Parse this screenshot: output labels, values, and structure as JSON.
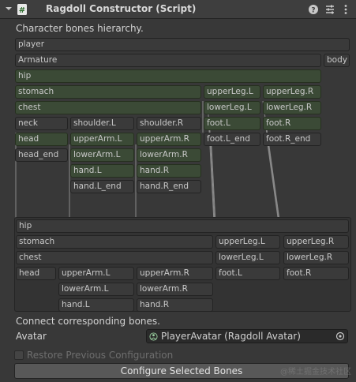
{
  "header": {
    "title": "Ragdoll Constructor (Script)",
    "icons": [
      "foldout-arrow-icon",
      "script-icon",
      "help-icon",
      "preset-icon",
      "context-menu-icon"
    ]
  },
  "section_hierarchy_label": "Character bones hierarchy.",
  "hierarchy": {
    "player": "player",
    "armature": "Armature",
    "body": "body",
    "hip": "hip",
    "stomach": "stomach",
    "chest": "chest",
    "neck": "neck",
    "head": "head",
    "head_end": "head_end",
    "shoulder_l": "shoulder.L",
    "upperarm_l": "upperArm.L",
    "lowerarm_l": "lowerArm.L",
    "hand_l": "hand.L",
    "hand_l_end": "hand.L_end",
    "shoulder_r": "shoulder.R",
    "upperarm_r": "upperArm.R",
    "lowerarm_r": "lowerArm.R",
    "hand_r": "hand.R",
    "hand_r_end": "hand.R_end",
    "upperleg_l": "upperLeg.L",
    "lowerleg_l": "lowerLeg.L",
    "foot_l": "foot.L",
    "foot_l_end": "foot.L_end",
    "upperleg_r": "upperLeg.R",
    "lowerleg_r": "lowerLeg.R",
    "foot_r": "foot.R",
    "foot_r_end": "foot.R_end"
  },
  "ragdoll": {
    "hip": "hip",
    "stomach": "stomach",
    "chest": "chest",
    "head": "head",
    "upperarm_l": "upperArm.L",
    "lowerarm_l": "lowerArm.L",
    "hand_l": "hand.L",
    "upperarm_r": "upperArm.R",
    "lowerarm_r": "lowerArm.R",
    "hand_r": "hand.R",
    "upperleg_l": "upperLeg.L",
    "lowerleg_l": "lowerLeg.L",
    "foot_l": "foot.L",
    "upperleg_r": "upperLeg.R",
    "lowerleg_r": "lowerLeg.R",
    "foot_r": "foot.R"
  },
  "connect_label": "Connect corresponding bones.",
  "avatar": {
    "label": "Avatar",
    "value": "PlayerAvatar (Ragdoll Avatar)"
  },
  "restore_label": "Restore Previous Configuration",
  "configure_button": "Configure Selected Bones",
  "watermark": "@稀土掘金技术社区",
  "colors": {
    "background": "#383838",
    "bone_selected": "#3b4a36",
    "bone_default": "#3a3a3a",
    "button": "#585858"
  }
}
